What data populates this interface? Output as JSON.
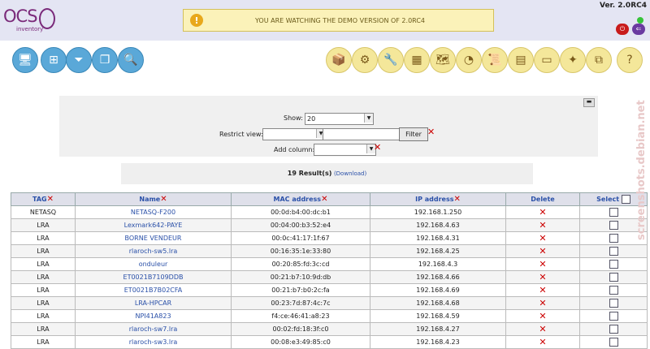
{
  "app": {
    "logo_text": "OCS",
    "logo_sub": "inventory",
    "version": "Ver. 2.0RC4",
    "demo_notice": "YOU ARE WATCHING THE DEMO VERSION OF 2.0RC4",
    "warn_glyph": "!",
    "logout_glyph": "⏻",
    "lang_glyph": "⇐"
  },
  "left_icons": [
    {
      "name": "computers-icon",
      "glyph": "🖥"
    },
    {
      "name": "network-icon",
      "glyph": "⊞"
    },
    {
      "name": "filter-icon",
      "glyph": "⏷"
    },
    {
      "name": "groups-icon",
      "glyph": "❐"
    },
    {
      "name": "search-icon",
      "glyph": "🔍"
    }
  ],
  "right_icons": [
    {
      "name": "deploy-icon",
      "glyph": "📦"
    },
    {
      "name": "config-icon",
      "glyph": "⚙"
    },
    {
      "name": "tools-icon",
      "glyph": "🔧"
    },
    {
      "name": "calculator-icon",
      "glyph": "▦"
    },
    {
      "name": "map-icon",
      "glyph": "🗺"
    },
    {
      "name": "pie-chart-icon",
      "glyph": "◔"
    },
    {
      "name": "scroll-icon",
      "glyph": "📜"
    },
    {
      "name": "firewall-icon",
      "glyph": "▤"
    },
    {
      "name": "card-icon",
      "glyph": "▭"
    },
    {
      "name": "agent-icon",
      "glyph": "✦"
    },
    {
      "name": "window-icon",
      "glyph": "⧉"
    },
    {
      "name": "help-icon",
      "glyph": "?"
    }
  ],
  "filters": {
    "show_label": "Show:",
    "show_value": "20",
    "restrict_label": "Restrict view:",
    "filter_button": "Filter",
    "add_column_label": "Add column:",
    "collapse_glyph": "▬",
    "clear_glyph": "✕",
    "arrow_glyph": "▼"
  },
  "results": {
    "text": "19 Result(s)",
    "download": "(Download)"
  },
  "table": {
    "headers": {
      "tag": "TAG",
      "name": "Name",
      "mac": "MAC address",
      "ip": "IP address",
      "delete": "Delete",
      "select": "Select"
    },
    "rows": [
      {
        "tag": "NETASQ",
        "name": "NETASQ-F200",
        "mac": "00:0d:b4:00:dc:b1",
        "ip": "192.168.1.250"
      },
      {
        "tag": "LRA",
        "name": "Lexmark642-PAYE",
        "mac": "00:04:00:b3:52:e4",
        "ip": "192.168.4.63"
      },
      {
        "tag": "LRA",
        "name": "BORNE VENDEUR",
        "mac": "00:0c:41:17:1f:67",
        "ip": "192.168.4.31"
      },
      {
        "tag": "LRA",
        "name": "rlaroch-sw5.lra",
        "mac": "00:16:35:1e:33:80",
        "ip": "192.168.4.25"
      },
      {
        "tag": "LRA",
        "name": "onduleur",
        "mac": "00:20:85:fd:3c:cd",
        "ip": "192.168.4.3"
      },
      {
        "tag": "LRA",
        "name": "ET0021B7109DDB",
        "mac": "00:21:b7:10:9d:db",
        "ip": "192.168.4.66"
      },
      {
        "tag": "LRA",
        "name": "ET0021B7B02CFA",
        "mac": "00:21:b7:b0:2c:fa",
        "ip": "192.168.4.69"
      },
      {
        "tag": "LRA",
        "name": "LRA-HPCAR",
        "mac": "00:23:7d:87:4c:7c",
        "ip": "192.168.4.68"
      },
      {
        "tag": "LRA",
        "name": "NPI41A823",
        "mac": "f4:ce:46:41:a8:23",
        "ip": "192.168.4.59"
      },
      {
        "tag": "LRA",
        "name": "rlaroch-sw7.lra",
        "mac": "00:02:fd:18:3f:c0",
        "ip": "192.168.4.27"
      },
      {
        "tag": "LRA",
        "name": "rlaroch-sw3.lra",
        "mac": "00:08:e3:49:85:c0",
        "ip": "192.168.4.23"
      }
    ],
    "delete_glyph": "✕",
    "sort_clear_glyph": "✕"
  },
  "watermark": "screenshots.debian.net"
}
